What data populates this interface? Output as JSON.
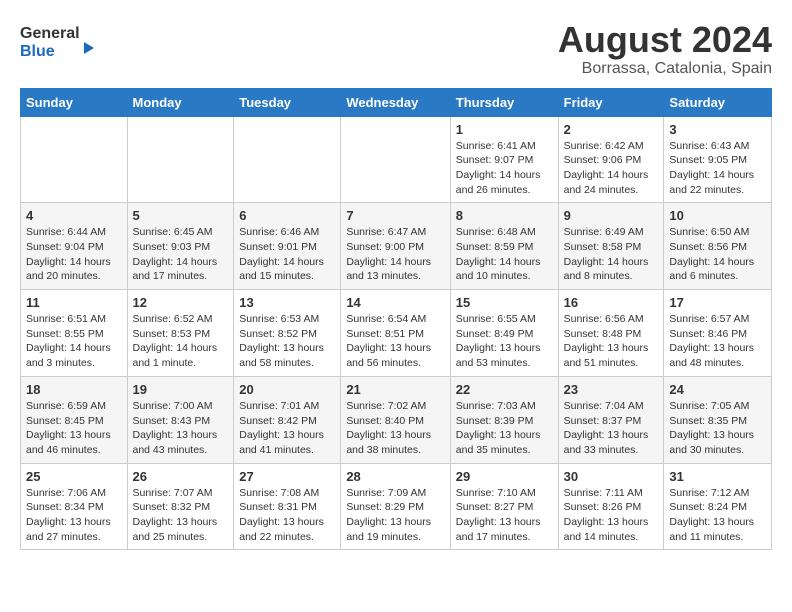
{
  "logo": {
    "line1": "General",
    "line2": "Blue"
  },
  "title": "August 2024",
  "subtitle": "Borrassa, Catalonia, Spain",
  "days_header": [
    "Sunday",
    "Monday",
    "Tuesday",
    "Wednesday",
    "Thursday",
    "Friday",
    "Saturday"
  ],
  "weeks": [
    [
      {
        "day": "",
        "detail": ""
      },
      {
        "day": "",
        "detail": ""
      },
      {
        "day": "",
        "detail": ""
      },
      {
        "day": "",
        "detail": ""
      },
      {
        "day": "1",
        "detail": "Sunrise: 6:41 AM\nSunset: 9:07 PM\nDaylight: 14 hours\nand 26 minutes."
      },
      {
        "day": "2",
        "detail": "Sunrise: 6:42 AM\nSunset: 9:06 PM\nDaylight: 14 hours\nand 24 minutes."
      },
      {
        "day": "3",
        "detail": "Sunrise: 6:43 AM\nSunset: 9:05 PM\nDaylight: 14 hours\nand 22 minutes."
      }
    ],
    [
      {
        "day": "4",
        "detail": "Sunrise: 6:44 AM\nSunset: 9:04 PM\nDaylight: 14 hours\nand 20 minutes."
      },
      {
        "day": "5",
        "detail": "Sunrise: 6:45 AM\nSunset: 9:03 PM\nDaylight: 14 hours\nand 17 minutes."
      },
      {
        "day": "6",
        "detail": "Sunrise: 6:46 AM\nSunset: 9:01 PM\nDaylight: 14 hours\nand 15 minutes."
      },
      {
        "day": "7",
        "detail": "Sunrise: 6:47 AM\nSunset: 9:00 PM\nDaylight: 14 hours\nand 13 minutes."
      },
      {
        "day": "8",
        "detail": "Sunrise: 6:48 AM\nSunset: 8:59 PM\nDaylight: 14 hours\nand 10 minutes."
      },
      {
        "day": "9",
        "detail": "Sunrise: 6:49 AM\nSunset: 8:58 PM\nDaylight: 14 hours\nand 8 minutes."
      },
      {
        "day": "10",
        "detail": "Sunrise: 6:50 AM\nSunset: 8:56 PM\nDaylight: 14 hours\nand 6 minutes."
      }
    ],
    [
      {
        "day": "11",
        "detail": "Sunrise: 6:51 AM\nSunset: 8:55 PM\nDaylight: 14 hours\nand 3 minutes."
      },
      {
        "day": "12",
        "detail": "Sunrise: 6:52 AM\nSunset: 8:53 PM\nDaylight: 14 hours\nand 1 minute."
      },
      {
        "day": "13",
        "detail": "Sunrise: 6:53 AM\nSunset: 8:52 PM\nDaylight: 13 hours\nand 58 minutes."
      },
      {
        "day": "14",
        "detail": "Sunrise: 6:54 AM\nSunset: 8:51 PM\nDaylight: 13 hours\nand 56 minutes."
      },
      {
        "day": "15",
        "detail": "Sunrise: 6:55 AM\nSunset: 8:49 PM\nDaylight: 13 hours\nand 53 minutes."
      },
      {
        "day": "16",
        "detail": "Sunrise: 6:56 AM\nSunset: 8:48 PM\nDaylight: 13 hours\nand 51 minutes."
      },
      {
        "day": "17",
        "detail": "Sunrise: 6:57 AM\nSunset: 8:46 PM\nDaylight: 13 hours\nand 48 minutes."
      }
    ],
    [
      {
        "day": "18",
        "detail": "Sunrise: 6:59 AM\nSunset: 8:45 PM\nDaylight: 13 hours\nand 46 minutes."
      },
      {
        "day": "19",
        "detail": "Sunrise: 7:00 AM\nSunset: 8:43 PM\nDaylight: 13 hours\nand 43 minutes."
      },
      {
        "day": "20",
        "detail": "Sunrise: 7:01 AM\nSunset: 8:42 PM\nDaylight: 13 hours\nand 41 minutes."
      },
      {
        "day": "21",
        "detail": "Sunrise: 7:02 AM\nSunset: 8:40 PM\nDaylight: 13 hours\nand 38 minutes."
      },
      {
        "day": "22",
        "detail": "Sunrise: 7:03 AM\nSunset: 8:39 PM\nDaylight: 13 hours\nand 35 minutes."
      },
      {
        "day": "23",
        "detail": "Sunrise: 7:04 AM\nSunset: 8:37 PM\nDaylight: 13 hours\nand 33 minutes."
      },
      {
        "day": "24",
        "detail": "Sunrise: 7:05 AM\nSunset: 8:35 PM\nDaylight: 13 hours\nand 30 minutes."
      }
    ],
    [
      {
        "day": "25",
        "detail": "Sunrise: 7:06 AM\nSunset: 8:34 PM\nDaylight: 13 hours\nand 27 minutes."
      },
      {
        "day": "26",
        "detail": "Sunrise: 7:07 AM\nSunset: 8:32 PM\nDaylight: 13 hours\nand 25 minutes."
      },
      {
        "day": "27",
        "detail": "Sunrise: 7:08 AM\nSunset: 8:31 PM\nDaylight: 13 hours\nand 22 minutes."
      },
      {
        "day": "28",
        "detail": "Sunrise: 7:09 AM\nSunset: 8:29 PM\nDaylight: 13 hours\nand 19 minutes."
      },
      {
        "day": "29",
        "detail": "Sunrise: 7:10 AM\nSunset: 8:27 PM\nDaylight: 13 hours\nand 17 minutes."
      },
      {
        "day": "30",
        "detail": "Sunrise: 7:11 AM\nSunset: 8:26 PM\nDaylight: 13 hours\nand 14 minutes."
      },
      {
        "day": "31",
        "detail": "Sunrise: 7:12 AM\nSunset: 8:24 PM\nDaylight: 13 hours\nand 11 minutes."
      }
    ]
  ]
}
